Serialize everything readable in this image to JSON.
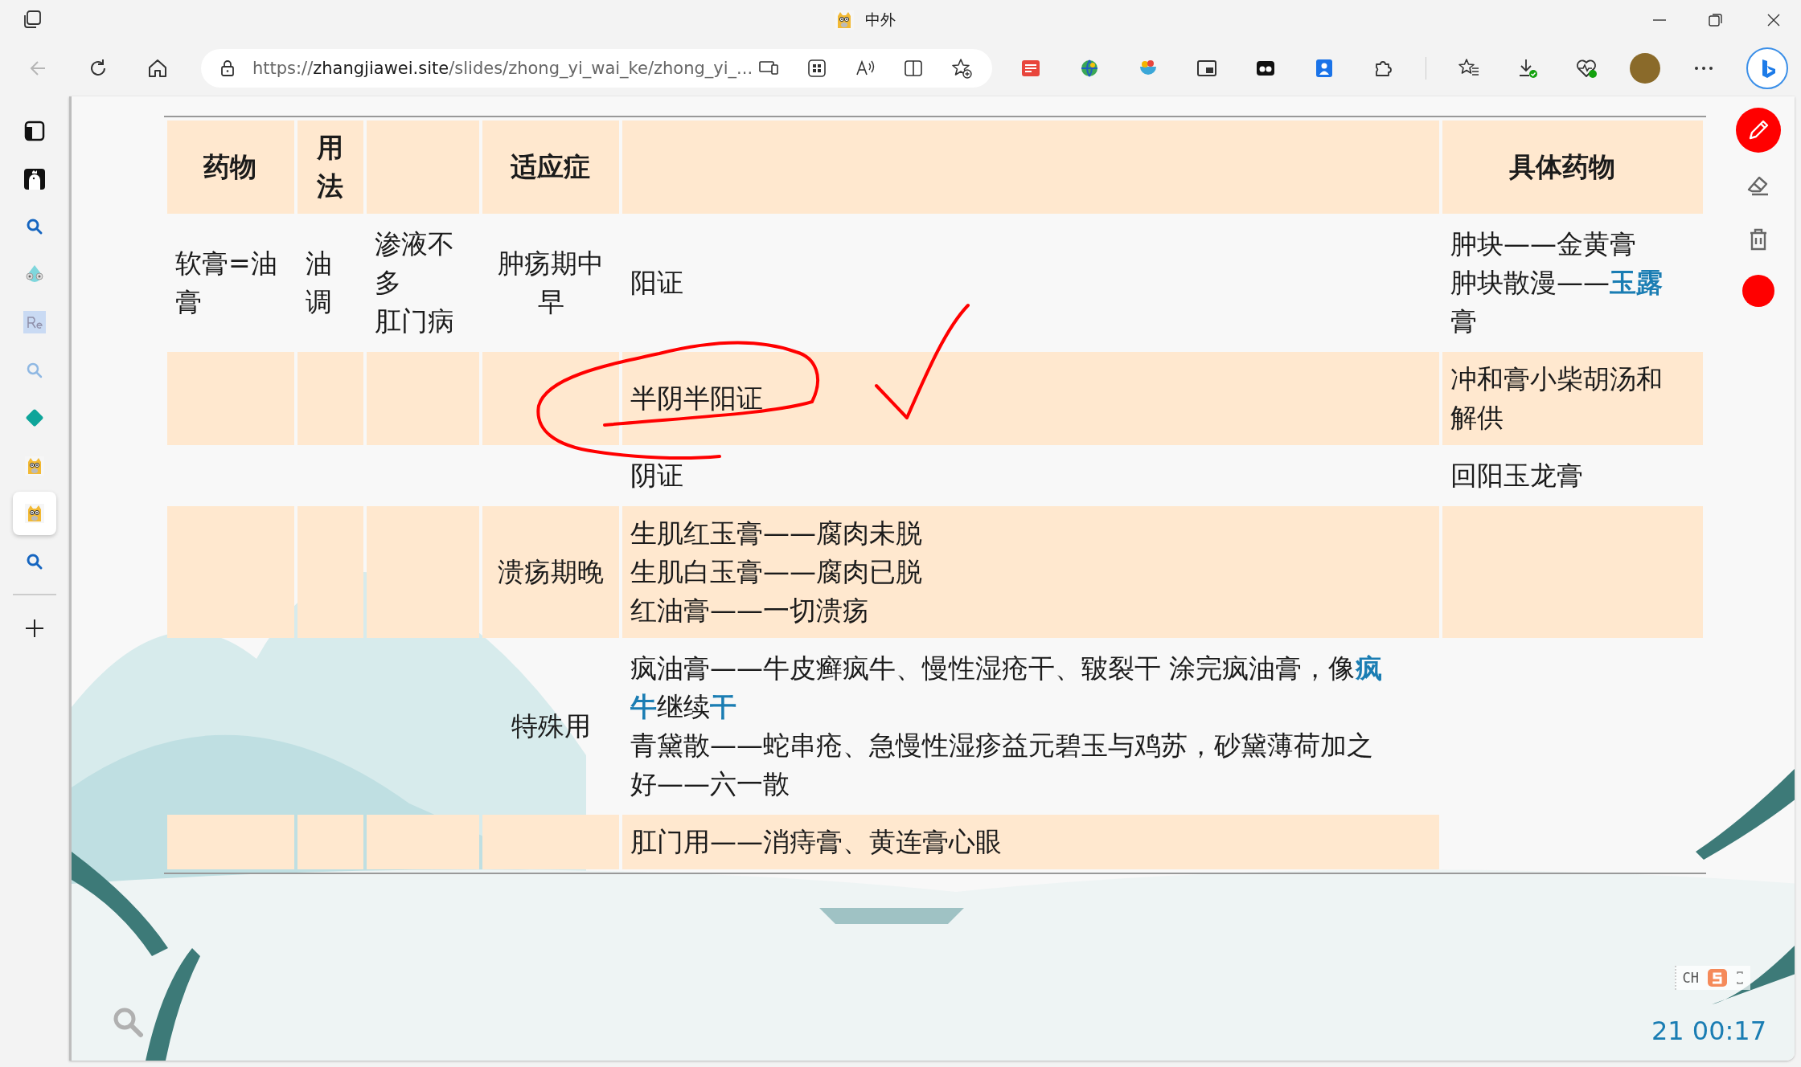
{
  "window": {
    "title": "中外"
  },
  "navigation": {
    "back": {
      "disabled": true
    }
  },
  "address_bar": {
    "scheme": "https://",
    "host": "zhangjiawei.site",
    "path": "/slides/zhong_yi_wai_ke/zhong_yi_..."
  },
  "sidebar": {
    "items": [
      {
        "kind": "panel",
        "selected": false
      },
      {
        "kind": "bird",
        "selected": false
      },
      {
        "kind": "search",
        "selected": false
      },
      {
        "kind": "chameleon",
        "selected": false
      },
      {
        "kind": "re",
        "selected": false
      },
      {
        "kind": "search-light",
        "selected": false
      },
      {
        "kind": "diamond",
        "selected": false
      },
      {
        "kind": "dog",
        "selected": false
      },
      {
        "kind": "dog",
        "selected": true
      },
      {
        "kind": "search",
        "selected": false
      }
    ]
  },
  "table": {
    "columns": [
      "药物",
      "用法",
      null,
      "适应症",
      null,
      "具体药物"
    ],
    "rows": [
      {
        "shaded": false,
        "cells": [
          "软膏=油膏",
          "油调",
          [
            "渗液不多",
            "肛门病"
          ],
          "肿疡期中早",
          "阳证",
          [
            "肿块——金黄膏",
            "肿块散漫——**玉露**膏"
          ]
        ]
      },
      {
        "shaded": true,
        "cells": [
          null,
          null,
          null,
          null,
          "半阴半阳证",
          "冲和膏小柴胡汤和解供"
        ]
      },
      {
        "shaded": false,
        "cells": [
          null,
          null,
          null,
          null,
          "阴证",
          "回阳玉龙膏"
        ]
      },
      {
        "shaded": true,
        "cells": [
          null,
          null,
          null,
          "溃疡期晚",
          [
            "生肌红玉膏——腐肉未脱",
            "生肌白玉膏——腐肉已脱",
            "红油膏——一切溃疡"
          ],
          null
        ]
      },
      {
        "shaded": false,
        "cells": [
          null,
          null,
          null,
          "特殊用",
          [
            "疯油膏——牛皮癣疯牛、慢性湿疮干、皲裂干 涂完疯油膏，像**疯牛**继续**干**",
            "青黛散——蛇串疮、急慢性湿疹益元碧玉与鸡苏，砂黛薄荷加之好——六一散"
          ],
          null
        ]
      },
      {
        "shaded": true,
        "cells": [
          null,
          null,
          null,
          null,
          "肛门用——消痔膏、黄连膏心眼"
        ]
      }
    ]
  },
  "ink_tools": [
    {
      "kind": "pen",
      "selected": true
    },
    {
      "kind": "eraser",
      "selected": false
    },
    {
      "kind": "clear",
      "selected": false
    }
  ],
  "ime": {
    "label": "CH"
  },
  "clock": "21 00:17"
}
